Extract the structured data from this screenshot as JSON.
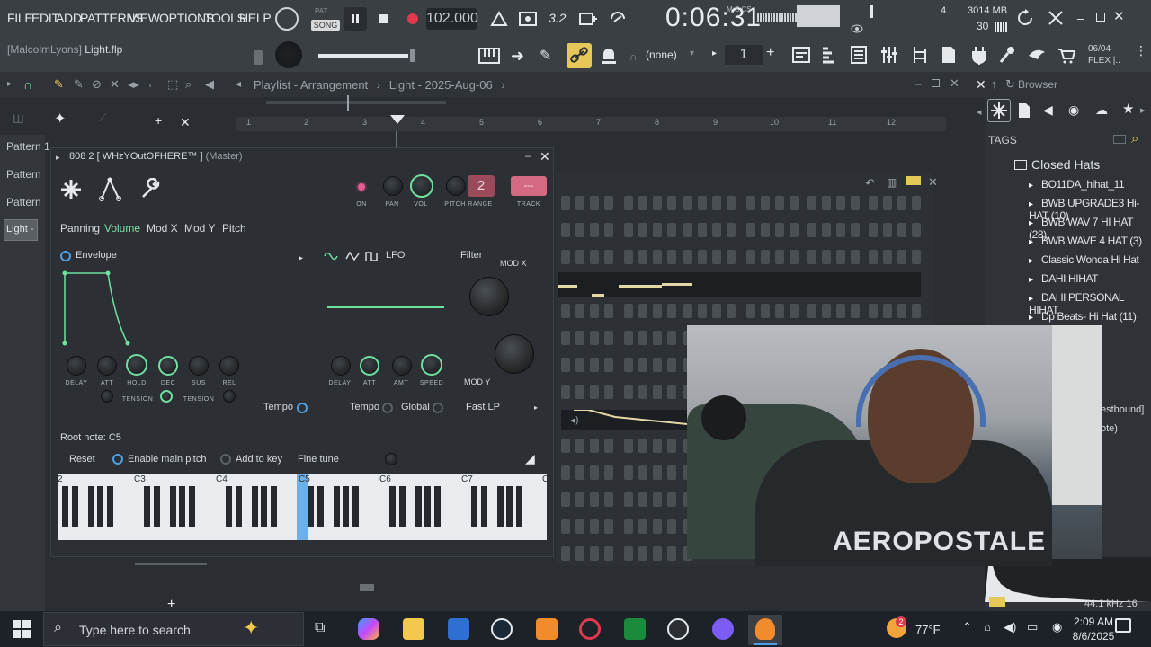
{
  "menu": [
    "FILE",
    "EDIT",
    "ADD",
    "PATTERNS",
    "VIEW",
    "OPTIONS",
    "TOOLS",
    "HELP"
  ],
  "transport": {
    "pat_label": "PAT",
    "song_label": "SONG",
    "tempo": "102.000",
    "time": "0:06:31",
    "time_unit": "M:S:CS"
  },
  "monitor": {
    "voices": "4",
    "memory": "3014 MB",
    "cpu": "30"
  },
  "toolbar2": {
    "project_user": "[MalcolmLyons]",
    "project_file": "Light.flp",
    "pattern_selector": "(none)",
    "pattern_number": "1",
    "flex_date": "06/04",
    "flex_label": "FLEX |.."
  },
  "playlist": {
    "title": "Playlist - Arrangement",
    "subtitle": "Light - 2025-Aug-06",
    "ruler": [
      "1",
      "2",
      "3",
      "4",
      "5",
      "6",
      "7",
      "8",
      "9",
      "10",
      "11",
      "12"
    ],
    "patterns": [
      "Pattern 1",
      "Pattern",
      "Pattern"
    ],
    "selected_pattern": "Light -"
  },
  "plugin": {
    "name": "808 2 [ WHzYOutOFHERE™ ]",
    "target": "(Master)",
    "knobs": {
      "on": "ON",
      "pan": "PAN",
      "vol": "VOL",
      "pitch": "PITCH",
      "range": "RANGE",
      "range_value": "2",
      "track": "TRACK",
      "track_value": "---"
    },
    "tabs": [
      "Panning",
      "Volume",
      "Mod X",
      "Mod Y",
      "Pitch"
    ],
    "active_tab": "Volume",
    "envelope": {
      "label": "Envelope",
      "knobs": [
        "DELAY",
        "ATT",
        "HOLD",
        "DEC",
        "SUS",
        "REL"
      ],
      "tension": "TENSION",
      "tempo": "Tempo"
    },
    "lfo": {
      "label": "LFO",
      "knobs": [
        "DELAY",
        "ATT",
        "AMT",
        "SPEED"
      ],
      "tempo": "Tempo",
      "global": "Global"
    },
    "filter": {
      "label": "Filter",
      "mod_x": "MOD X",
      "mod_y": "MOD Y",
      "type": "Fast LP"
    },
    "root_note": "Root note: C5",
    "reset": "Reset",
    "enable_main_pitch": "Enable main pitch",
    "add_to_key": "Add to key",
    "fine_tune": "Fine tune",
    "keyboard_octaves": [
      "2",
      "C3",
      "C4",
      "C5",
      "C6",
      "C7",
      "C"
    ]
  },
  "browser": {
    "title": "Browser",
    "tags": "TAGS",
    "folder": "Closed Hats",
    "items": [
      "BO11DA_hihat_11",
      "BWB UPGRADE3 Hi-HAT (10)",
      "BWB WAV 7 HI HAT (28)",
      "BWB WAVE 4 HAT (3)",
      "Classic Wonda Hi Hat",
      "DAHI HIHAT",
      "DAHI PERSONAL HIHAT",
      "Dp Beats- Hi Hat (11)"
    ],
    "partial1": "estbound]",
    "partial2": "ote)",
    "audio_info": "44.1 kHz 16"
  },
  "webcam": {
    "shirt": "AEROPOSTALE"
  },
  "taskbar": {
    "search_placeholder": "Type here to search",
    "weather": "77°F",
    "time": "2:09 AM",
    "date": "8/6/2025",
    "notification_count": "2"
  },
  "colors": {
    "accent_green": "#6fe0a0",
    "link_yellow": "#e6c85a",
    "track_pink": "#d46a82",
    "record_red": "#e0394d"
  }
}
